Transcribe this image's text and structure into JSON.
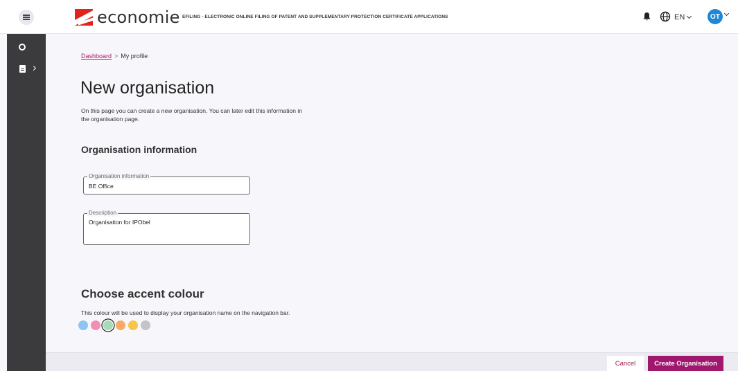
{
  "header": {
    "logo_text": "economie",
    "app_title": "EFILING - ELECTRONIC ONLINE FILING OF PATENT AND SUPPLEMENTARY PROTECTION CERTIFICATE APPLICATIONS",
    "language": "EN",
    "avatar_initials": "OT",
    "icons": [
      "hamburger-menu-icon",
      "economie-logo",
      "bell-icon",
      "globe-icon",
      "chevron-down-icon"
    ]
  },
  "sidebar": {
    "icons": [
      "ring-icon",
      "document-icon",
      "chevron-right-icon"
    ]
  },
  "breadcrumb": {
    "link": "Dashboard",
    "separator": ">",
    "current": "My profile"
  },
  "main": {
    "title": "New organisation",
    "intro": "On this page you can create a new organisation. You can later edit this information in the organisation page.",
    "section_title": "Organisation information",
    "fields": {
      "name": {
        "label": "Organisation information",
        "value": "BE Office"
      },
      "description": {
        "label": "Description",
        "value": "Organisation for IPObel"
      }
    },
    "accent": {
      "title": "Choose accent colour",
      "description": "This colour will be used to display your organisation name on the navigation bar.",
      "colors": [
        "#8fc3f3",
        "#f28fb7",
        "#a6dcb4",
        "#fbab66",
        "#f7c54a",
        "#c3c3c8"
      ],
      "selected_index": 2
    }
  },
  "footer": {
    "cancel_label": "Cancel",
    "create_label": "Create Organisation"
  }
}
